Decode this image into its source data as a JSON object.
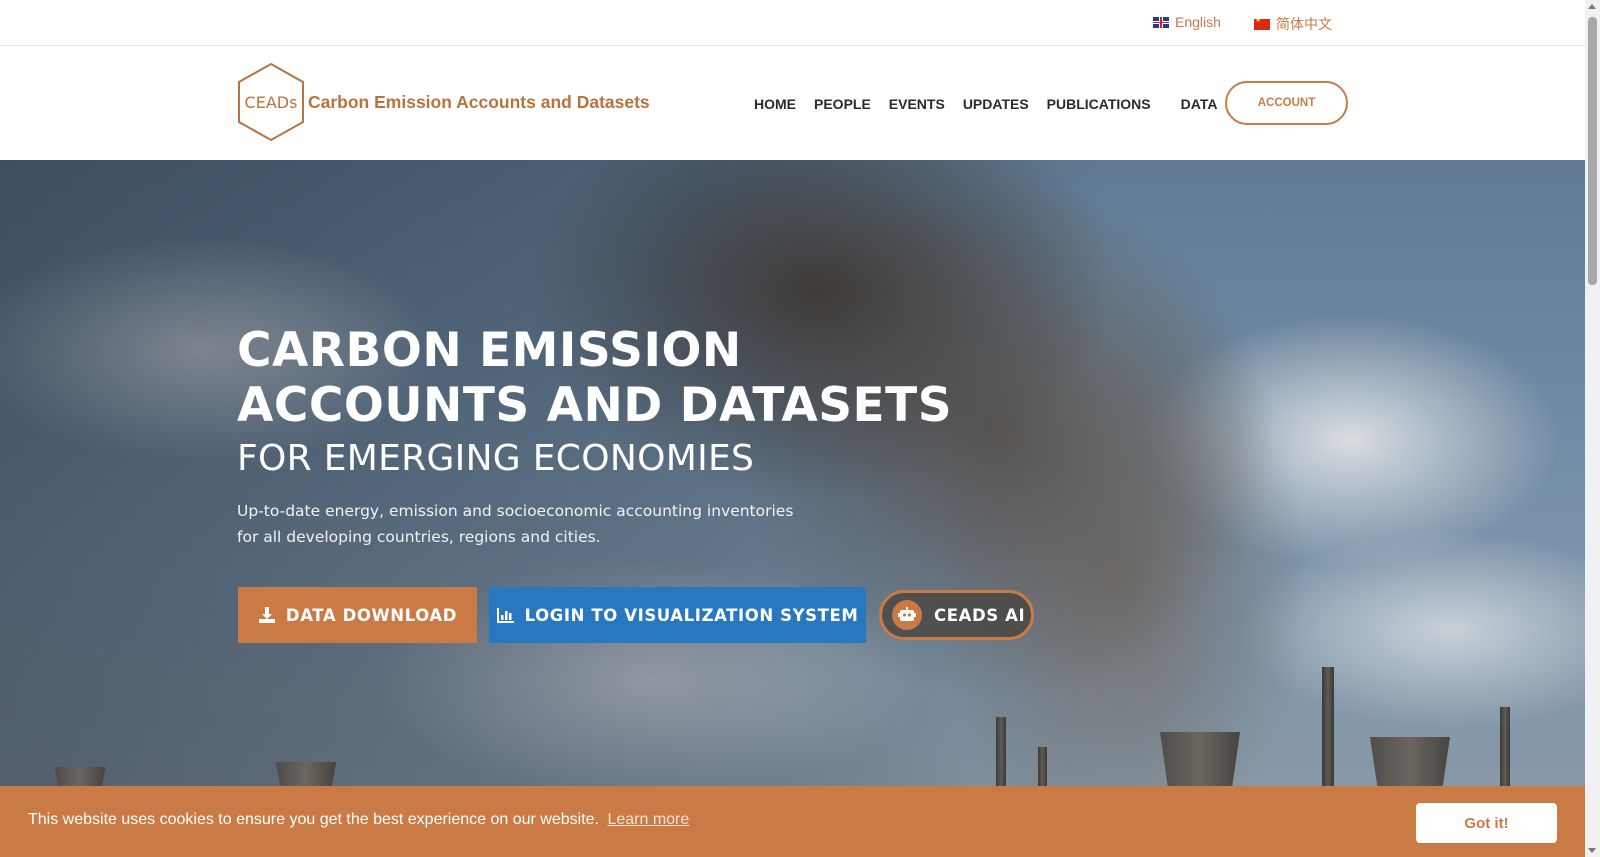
{
  "langbar": {
    "english": "English",
    "chinese": "简体中文"
  },
  "header": {
    "logo_mark": "CEADs",
    "site_name": "Carbon Emission Accounts and Datasets",
    "nav": [
      "HOME",
      "PEOPLE",
      "EVENTS",
      "UPDATES",
      "PUBLICATIONS",
      "DATA"
    ],
    "account_label": "ACCOUNT"
  },
  "hero": {
    "title_line1": "CARBON EMISSION",
    "title_line2": "ACCOUNTS AND DATASETS",
    "subtitle": "FOR EMERGING ECONOMIES",
    "desc_line1": "Up-to-date energy, emission and socioeconomic accounting inventories",
    "desc_line2": "for all developing countries, regions and cities.",
    "btn_download": "DATA DOWNLOAD",
    "btn_login": "LOGIN TO VISUALIZATION SYSTEM",
    "btn_ai": "CEADS AI"
  },
  "cookie": {
    "message": "This website uses cookies to ensure you get the best experience on our website.",
    "learn_more": "Learn more",
    "accept": "Got it!"
  },
  "colors": {
    "accent": "#c97a45",
    "login_blue": "#2878c0",
    "nav_text": "#2b2b2b"
  },
  "icons": {
    "download": "download-icon",
    "chart": "bar-chart-icon",
    "robot": "robot-icon"
  }
}
